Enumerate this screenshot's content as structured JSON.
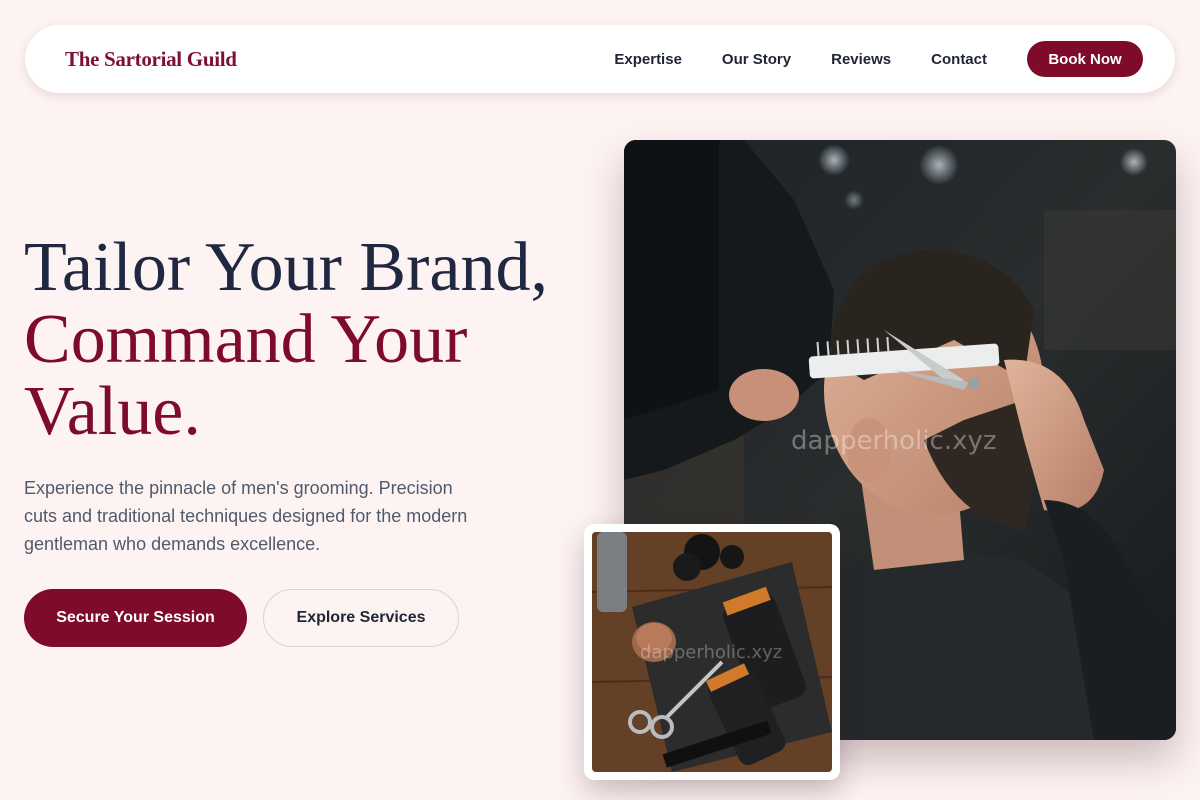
{
  "nav": {
    "brand": "The Sartorial Guild",
    "links": [
      "Expertise",
      "Our Story",
      "Reviews",
      "Contact"
    ],
    "cta": "Book Now"
  },
  "hero": {
    "title_line1": "Tailor Your Brand,",
    "title_line2": "Command Your Value.",
    "subtitle": "Experience the pinnacle of men's grooming. Precision cuts and traditional techniques designed for the modern gentleman who demands excellence.",
    "primary_button": "Secure Your Session",
    "secondary_button": "Explore Services"
  },
  "images": {
    "main_watermark": "dapperholic.xyz",
    "inset_watermark": "dapperholic.xyz"
  },
  "colors": {
    "accent": "#7e0b2a",
    "heading": "#1f2840",
    "background": "#fdf3f2"
  }
}
